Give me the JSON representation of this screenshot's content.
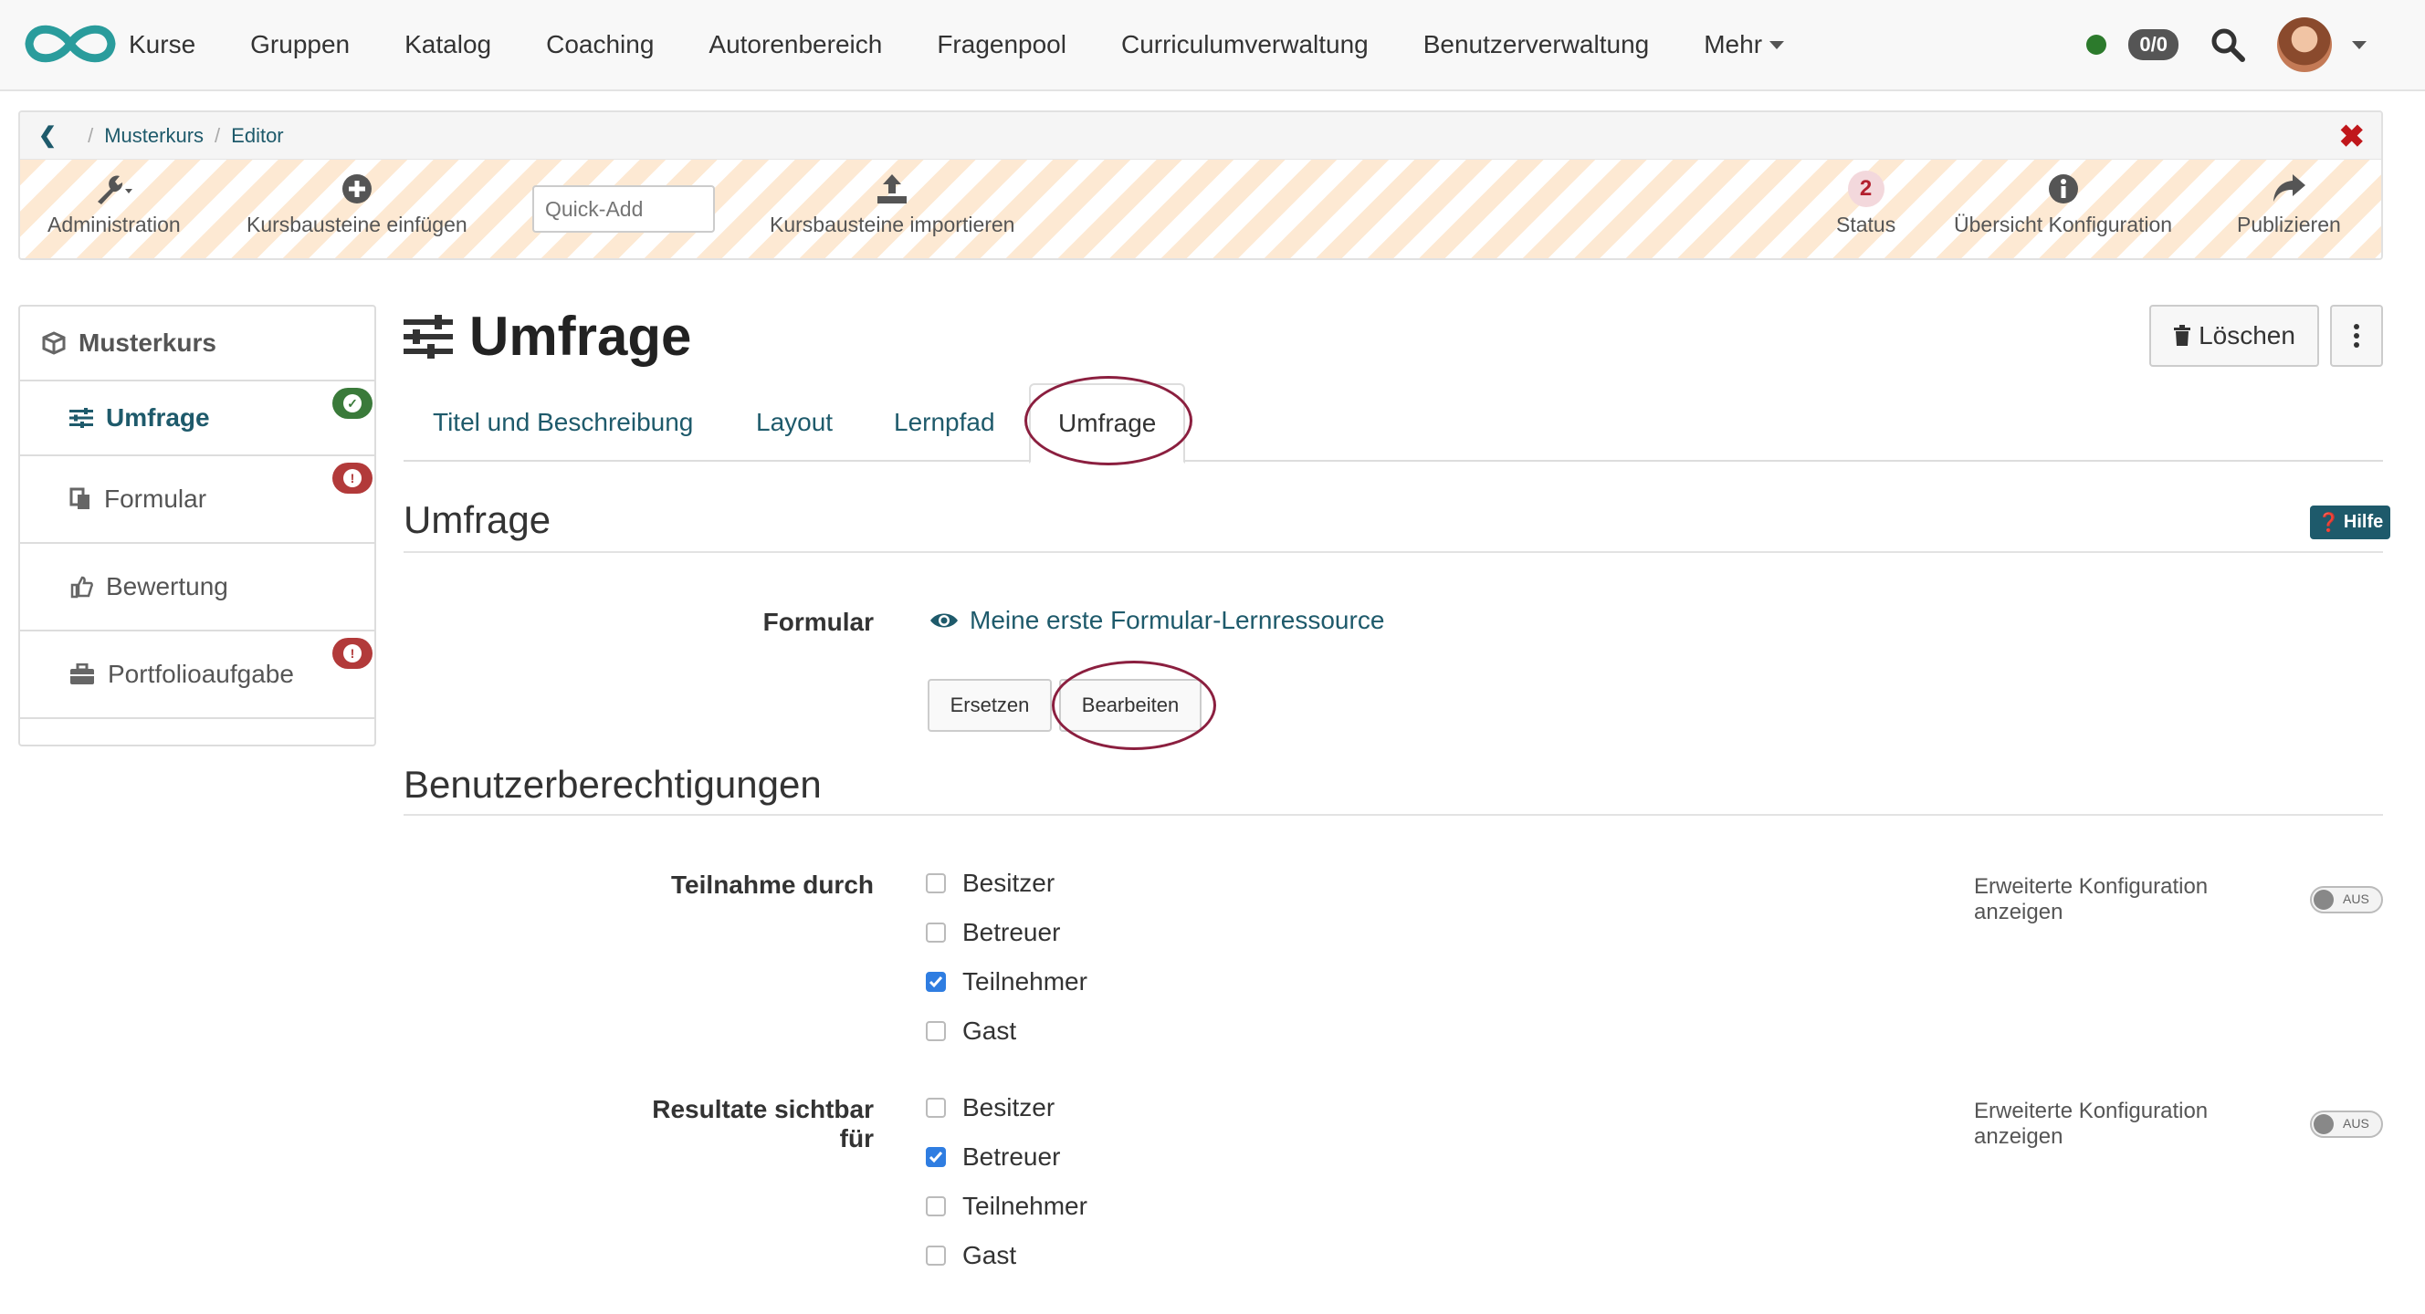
{
  "nav": {
    "items": [
      "Kurse",
      "Gruppen",
      "Katalog",
      "Coaching",
      "Autorenbereich",
      "Fragenpool",
      "Curriculumverwaltung",
      "Benutzerverwaltung"
    ],
    "more_label": "Mehr",
    "counter": "0/0",
    "online_color": "#2c7a2c"
  },
  "breadcrumb": {
    "course": "Musterkurs",
    "page": "Editor"
  },
  "toolbar": {
    "administration": "Administration",
    "insert": "Kursbausteine einfügen",
    "quick_add_placeholder": "Quick-Add",
    "import": "Kursbausteine importieren",
    "status_count": "2",
    "status": "Status",
    "overview": "Übersicht Konfiguration",
    "publish": "Publizieren"
  },
  "sidebar": {
    "root": "Musterkurs",
    "items": [
      {
        "label": "Umfrage",
        "status": "ok"
      },
      {
        "label": "Formular",
        "status": "error"
      },
      {
        "label": "Bewertung",
        "status": ""
      },
      {
        "label": "Portfolioaufgabe",
        "status": "error"
      }
    ]
  },
  "page": {
    "title": "Umfrage",
    "delete": "Löschen",
    "tabs": [
      "Titel und Beschreibung",
      "Layout",
      "Lernpfad",
      "Umfrage"
    ],
    "active_tab": "Umfrage",
    "help": "Hilfe"
  },
  "survey": {
    "heading": "Umfrage",
    "form_label": "Formular",
    "form_link": "Meine erste Formular-Lernressource",
    "replace": "Ersetzen",
    "edit": "Bearbeiten"
  },
  "permissions": {
    "heading": "Benutzerberechtigungen",
    "advanced_label": "Erweiterte Konfiguration anzeigen",
    "toggle_text": "AUS",
    "groups": [
      {
        "label": "Teilnahme durch",
        "options": [
          {
            "label": "Besitzer",
            "checked": false
          },
          {
            "label": "Betreuer",
            "checked": false
          },
          {
            "label": "Teilnehmer",
            "checked": true
          },
          {
            "label": "Gast",
            "checked": false
          }
        ]
      },
      {
        "label": "Resultate sichtbar für",
        "options": [
          {
            "label": "Besitzer",
            "checked": false
          },
          {
            "label": "Betreuer",
            "checked": true
          },
          {
            "label": "Teilnehmer",
            "checked": false
          },
          {
            "label": "Gast",
            "checked": false
          }
        ]
      }
    ]
  },
  "colors": {
    "accent": "#1e5a6b",
    "highlight_ellipse": "#8b1f3f",
    "checkbox": "#2f7de1"
  }
}
